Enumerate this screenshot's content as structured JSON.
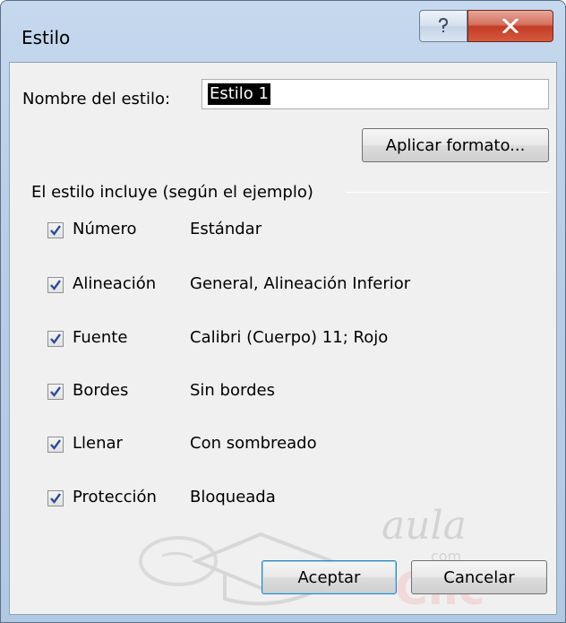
{
  "window": {
    "title": "Estilo"
  },
  "name_field": {
    "label": "Nombre del estilo:",
    "value": "Estilo 1"
  },
  "buttons": {
    "apply_format": "Aplicar formato...",
    "accept": "Aceptar",
    "cancel": "Cancelar"
  },
  "group": {
    "label": "El estilo incluye (según el ejemplo)"
  },
  "options": [
    {
      "label": "Número",
      "accel": "N",
      "value": "Estándar",
      "checked": true
    },
    {
      "label": "Alineación",
      "accel": "l",
      "value": "General, Alineación Inferior",
      "checked": true
    },
    {
      "label": "Fuente",
      "accel": "F",
      "value": "Calibri (Cuerpo) 11; Rojo",
      "checked": true
    },
    {
      "label": "Bordes",
      "accel": "B",
      "value": "Sin bordes",
      "checked": true
    },
    {
      "label": "Llenar",
      "accel": "e",
      "value": "Con sombreado",
      "checked": true
    },
    {
      "label": "Protección",
      "accel": "P",
      "value": "Bloqueada",
      "checked": true
    }
  ],
  "watermark": {
    "text1": "aula",
    "text2": "Clic",
    "text3": "com"
  },
  "icons": [
    "help-icon",
    "close-icon",
    "checkmark-icon"
  ]
}
